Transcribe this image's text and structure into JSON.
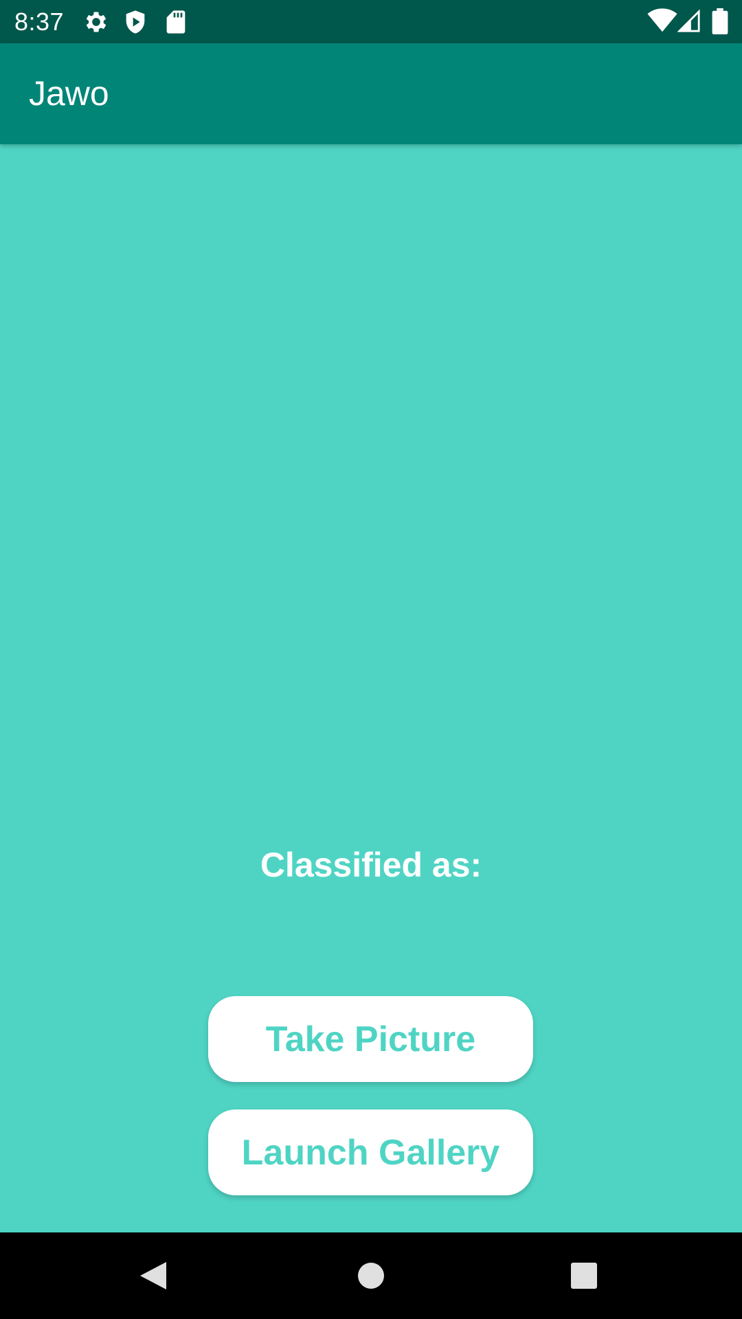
{
  "status_bar": {
    "time": "8:37",
    "icons": [
      "gear-icon",
      "shield-play-icon",
      "sd-card-icon",
      "wifi-icon",
      "signal-icon",
      "battery-icon"
    ]
  },
  "app_bar": {
    "title": "Jawo"
  },
  "main": {
    "result_label": "Classified as:",
    "take_picture_label": "Take Picture",
    "launch_gallery_label": "Launch Gallery"
  },
  "nav_bar": {
    "icons": [
      "back-icon",
      "home-icon",
      "recents-icon"
    ]
  },
  "colors": {
    "status_bar": "#00574b",
    "app_bar": "#008577",
    "background": "#4fd4c4",
    "button": "#ffffff",
    "button_text": "#4fd4c4"
  }
}
